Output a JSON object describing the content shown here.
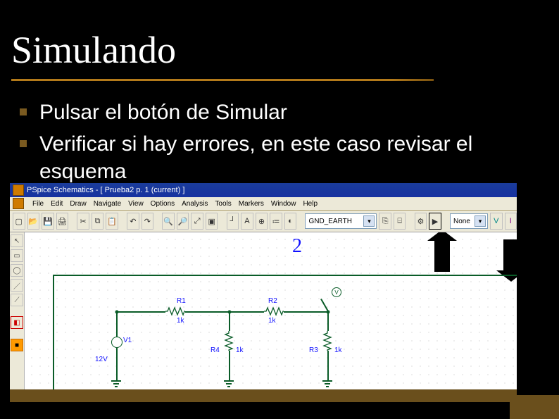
{
  "slide": {
    "title": "Simulando",
    "bullets": [
      "Pulsar el botón de Simular",
      "Verificar si hay errores, en este caso revisar el esquema"
    ]
  },
  "app": {
    "window_title": "PSpice Schematics - [ Prueba2  p. 1 (current)  ]",
    "menus": [
      "File",
      "Edit",
      "Draw",
      "Navigate",
      "View",
      "Options",
      "Analysis",
      "Tools",
      "Markers",
      "Window",
      "Help"
    ],
    "toolbar": {
      "gnd_dropdown": "GND_EARTH",
      "none_dropdown": "None"
    },
    "canvas_marker_label": "2",
    "circuit": {
      "source": {
        "name": "V1",
        "value": "12V"
      },
      "r1": {
        "name": "R1",
        "value": "1k"
      },
      "r2": {
        "name": "R2",
        "value": "1k"
      },
      "r3": {
        "name": "R3",
        "value": "1k"
      },
      "r4": {
        "name": "R4",
        "value": "1k"
      },
      "probe": {
        "label": "V"
      }
    }
  }
}
